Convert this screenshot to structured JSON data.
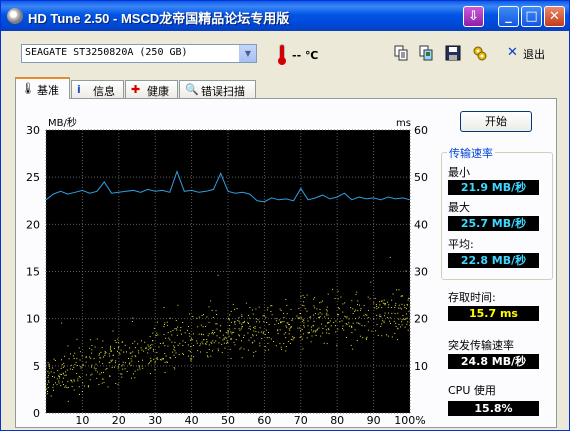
{
  "window": {
    "title": "HD Tune 2.50 - MSCD龙帝国精品论坛专用版"
  },
  "toolbar": {
    "drive": "SEAGATE ST3250820A (250 GB)",
    "temperature": "-- ℃",
    "exit_label": "退出",
    "icons": [
      "copy-text-icon",
      "copy-screenshot-icon",
      "save-icon",
      "options-icon"
    ]
  },
  "tabs": [
    {
      "label": "基准",
      "icon": "benchmark-icon",
      "active": true
    },
    {
      "label": "信息",
      "icon": "info-icon",
      "active": false
    },
    {
      "label": "健康",
      "icon": "health-icon",
      "active": false
    },
    {
      "label": "错误扫描",
      "icon": "error-scan-icon",
      "active": false
    }
  ],
  "controls": {
    "start_label": "开始"
  },
  "stats": {
    "transfer_rate_title": "传输速率",
    "min_label": "最小",
    "min_value": "21.9 MB/秒",
    "max_label": "最大",
    "max_value": "25.7 MB/秒",
    "avg_label": "平均:",
    "avg_value": "22.8 MB/秒",
    "access_label": "存取时间:",
    "access_value": "15.7 ms",
    "burst_label": "突发传输速率",
    "burst_value": "24.8 MB/秒",
    "cpu_label": "CPU 使用",
    "cpu_value": "15.8%"
  },
  "colors": {
    "transfer_line": "#2f9fe0",
    "access_dots": "#e8e040",
    "plot_bg": "#000000",
    "grid": "#5a5a5a"
  },
  "chart_data": {
    "type": "line",
    "y_left_label": "MB/秒",
    "y_right_label": "ms",
    "ylim_left": [
      0,
      30
    ],
    "ylim_right": [
      0,
      60
    ],
    "y_left_ticks": [
      "0",
      "5",
      "10",
      "15",
      "20",
      "25",
      "30"
    ],
    "y_right_ticks": [
      "0",
      "10",
      "20",
      "30",
      "40",
      "50",
      "60"
    ],
    "x_ticks": [
      "0",
      "10",
      "20",
      "30",
      "40",
      "50",
      "60",
      "70",
      "80",
      "90",
      "100%"
    ],
    "grid": true,
    "series": [
      {
        "role": "transfer rate (MB/s, left axis)",
        "x": [
          0,
          2,
          4,
          6,
          8,
          10,
          12,
          14,
          16,
          18,
          20,
          22,
          24,
          26,
          28,
          30,
          32,
          34,
          36,
          38,
          40,
          42,
          44,
          46,
          48,
          50,
          52,
          54,
          56,
          58,
          60,
          62,
          64,
          66,
          68,
          70,
          72,
          74,
          76,
          78,
          80,
          82,
          84,
          86,
          88,
          90,
          92,
          94,
          96,
          98,
          100
        ],
        "values": [
          22.6,
          23.2,
          23.5,
          23.2,
          23.4,
          23.6,
          23.3,
          23.5,
          24.5,
          23.3,
          23.4,
          23.5,
          23.6,
          23.4,
          23.7,
          23.5,
          23.6,
          23.4,
          25.6,
          23.5,
          23.6,
          23.4,
          23.5,
          23.7,
          25.4,
          23.5,
          23.3,
          23.4,
          23.2,
          22.5,
          22.4,
          22.8,
          22.6,
          22.7,
          22.5,
          23.8,
          22.6,
          22.8,
          23.1,
          22.7,
          22.9,
          23.3,
          22.6,
          22.9,
          22.7,
          22.8,
          22.6,
          22.9,
          22.7,
          22.8,
          22.6
        ]
      },
      {
        "role": "access time (ms, right axis)",
        "type": "scatter",
        "trend_x": [
          0,
          10,
          20,
          30,
          40,
          50,
          60,
          70,
          80,
          90,
          100
        ],
        "trend_values": [
          7,
          10,
          12,
          14,
          15.5,
          17,
          18,
          19,
          20,
          20.5,
          21
        ],
        "spread": 4
      }
    ]
  }
}
